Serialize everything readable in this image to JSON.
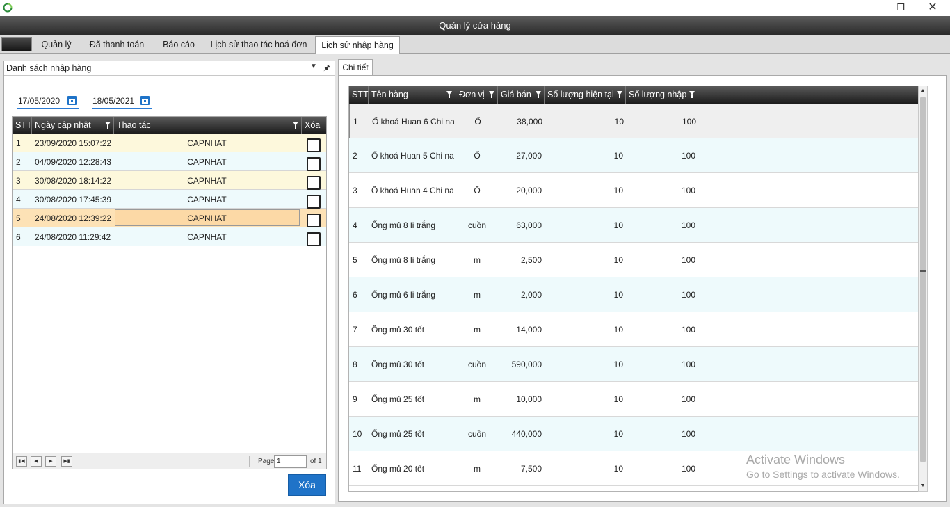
{
  "window": {
    "title": "Quản lý cửa hàng"
  },
  "tabs": [
    {
      "label": "Quản lý"
    },
    {
      "label": "Đã thanh toán"
    },
    {
      "label": "Báo cáo"
    },
    {
      "label": "Lịch sử thao tác hoá đơn"
    },
    {
      "label": "Lịch sử nhập hàng",
      "active": true
    }
  ],
  "left_panel": {
    "title": "Danh sách nhập hàng",
    "date_from": "17/05/2020",
    "date_to": "18/05/2021",
    "grid": {
      "columns": [
        "STT",
        "Ngày cập nhật",
        "Thao tác",
        "Xóa"
      ],
      "rows": [
        {
          "stt": "1",
          "date": "23/09/2020 15:07:22",
          "action": "CAPNHAT"
        },
        {
          "stt": "2",
          "date": "04/09/2020 12:28:43",
          "action": "CAPNHAT"
        },
        {
          "stt": "3",
          "date": "30/08/2020 18:14:22",
          "action": "CAPNHAT"
        },
        {
          "stt": "4",
          "date": "30/08/2020 17:45:39",
          "action": "CAPNHAT"
        },
        {
          "stt": "5",
          "date": "24/08/2020 12:39:22",
          "action": "CAPNHAT",
          "selected": true
        },
        {
          "stt": "6",
          "date": "24/08/2020 11:29:42",
          "action": "CAPNHAT"
        }
      ]
    },
    "pager": {
      "page_label": "Page",
      "page_value": "1",
      "of_label": "of 1"
    },
    "delete_button": "Xóa"
  },
  "right_panel": {
    "tab": "Chi tiết",
    "grid": {
      "columns": [
        "STT",
        "Tên hàng",
        "Đơn vị",
        "Giá bán",
        "Số lượng hiện tại",
        "Số lượng nhập"
      ],
      "rows": [
        {
          "stt": "1",
          "name": "Ổ khoá Huan 6 Chi na",
          "unit": "Ổ",
          "price": "38,000",
          "current": "10",
          "imported": "100"
        },
        {
          "stt": "2",
          "name": "Ổ khoá Huan 5 Chi na",
          "unit": "Ổ",
          "price": "27,000",
          "current": "10",
          "imported": "100"
        },
        {
          "stt": "3",
          "name": "Ổ khoá Huan 4 Chi na",
          "unit": "Ổ",
          "price": "20,000",
          "current": "10",
          "imported": "100"
        },
        {
          "stt": "4",
          "name": "Ống mủ 8 li trắng",
          "unit": "cuồn",
          "price": "63,000",
          "current": "10",
          "imported": "100"
        },
        {
          "stt": "5",
          "name": "Ống mủ 8 li trắng",
          "unit": "m",
          "price": "2,500",
          "current": "10",
          "imported": "100"
        },
        {
          "stt": "6",
          "name": "Ống mủ 6 li trắng",
          "unit": "m",
          "price": "2,000",
          "current": "10",
          "imported": "100"
        },
        {
          "stt": "7",
          "name": "Ống mủ 30 tốt",
          "unit": "m",
          "price": "14,000",
          "current": "10",
          "imported": "100"
        },
        {
          "stt": "8",
          "name": "Ống mủ 30 tốt",
          "unit": "cuồn",
          "price": "590,000",
          "current": "10",
          "imported": "100"
        },
        {
          "stt": "9",
          "name": "Ống mủ 25 tốt",
          "unit": "m",
          "price": "10,000",
          "current": "10",
          "imported": "100"
        },
        {
          "stt": "10",
          "name": "Ống mủ 25 tốt",
          "unit": "cuồn",
          "price": "440,000",
          "current": "10",
          "imported": "100"
        },
        {
          "stt": "11",
          "name": "Ống mủ 20 tốt",
          "unit": "m",
          "price": "7,500",
          "current": "10",
          "imported": "100"
        }
      ]
    }
  },
  "watermark": {
    "line1": "Activate Windows",
    "line2": "Go to Settings to activate Windows."
  },
  "colors": {
    "accent": "#1f73c8",
    "row_yellow": "#fdf8dc",
    "row_blue": "#eefafc",
    "row_selected": "#fde2b6"
  }
}
